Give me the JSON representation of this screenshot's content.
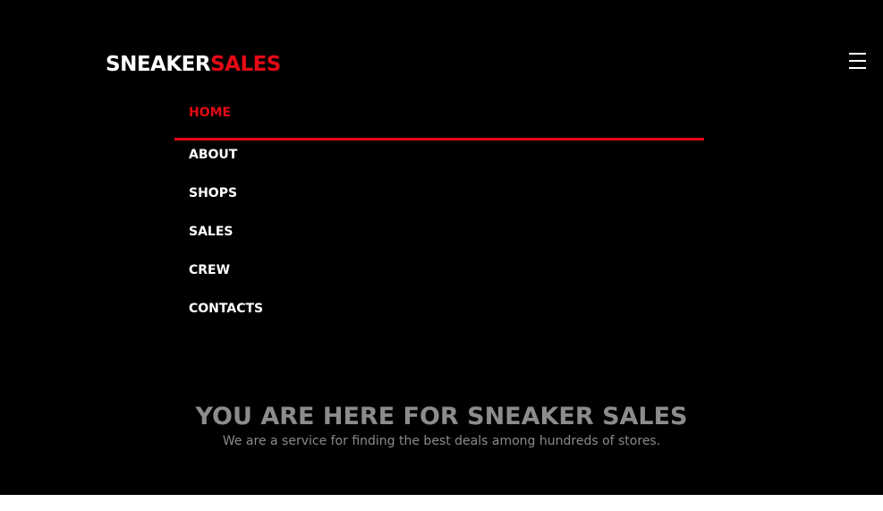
{
  "header": {
    "logo_part_1": "SNEAKER",
    "logo_part_2": "SALES",
    "menu_icon": "hamburger-menu-icon"
  },
  "nav": {
    "items": [
      {
        "label": "HOME",
        "active": true
      },
      {
        "label": "ABOUT",
        "active": false
      },
      {
        "label": "SHOPS",
        "active": false
      },
      {
        "label": "SALES",
        "active": false
      },
      {
        "label": "CREW",
        "active": false
      },
      {
        "label": "CONTACTS",
        "active": false
      }
    ]
  },
  "hero": {
    "title": "YOU ARE HERE FOR SNEAKER SALES",
    "subtitle": "We are a service for finding the best deals among hundreds of stores."
  },
  "colors": {
    "background": "#000000",
    "accent": "#e50914",
    "text": "#ffffff",
    "muted": "#8c8c8c"
  }
}
